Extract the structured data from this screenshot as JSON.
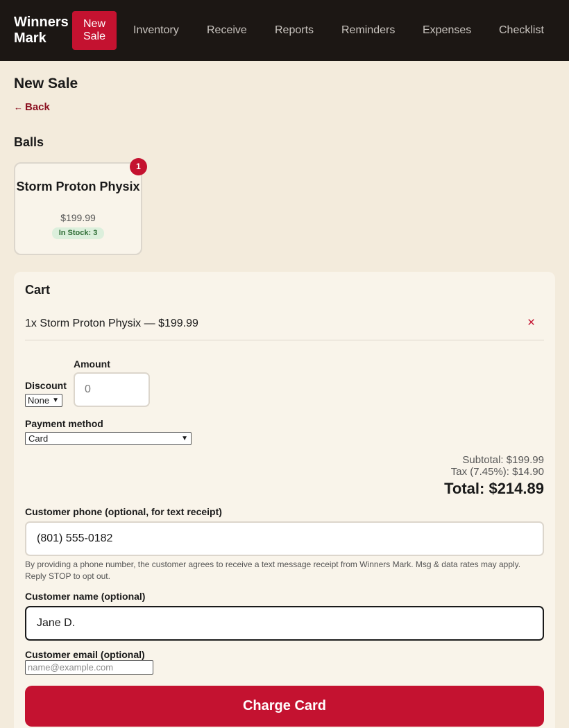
{
  "nav": {
    "brand": "Winners Mark",
    "items": [
      {
        "label": "New Sale",
        "active": true
      },
      {
        "label": "Inventory"
      },
      {
        "label": "Receive"
      },
      {
        "label": "Reports"
      },
      {
        "label": "Reminders"
      },
      {
        "label": "Expenses"
      },
      {
        "label": "Checklist"
      }
    ]
  },
  "page": {
    "title": "New Sale",
    "back_arrow": "←",
    "back_label": "Back"
  },
  "catalog": {
    "section_title": "Balls",
    "products": [
      {
        "name": "Storm Proton Physix",
        "price": "$199.99",
        "stock": "In Stock: 3",
        "cart_count": "1"
      }
    ]
  },
  "cart": {
    "title": "Cart",
    "items": [
      {
        "text": "1x Storm Proton Physix — $199.99",
        "remove_icon": "×"
      }
    ],
    "discount": {
      "label": "Discount",
      "selected": "None",
      "amount_label": "Amount",
      "amount_placeholder": "0"
    },
    "payment": {
      "label": "Payment method",
      "selected": "Card"
    },
    "totals": {
      "subtotal": "Subtotal: $199.99",
      "tax": "Tax (7.45%): $14.90",
      "total": "Total: $214.89"
    },
    "customer_phone": {
      "label": "Customer phone (optional, for text receipt)",
      "value": "(801) 555-0182"
    },
    "consent_text": "By providing a phone number, the customer agrees to receive a text message receipt from Winners Mark. Msg & data rates may apply. Reply STOP to opt out.",
    "customer_name": {
      "label": "Customer name (optional)",
      "value": "Jane D."
    },
    "customer_email": {
      "label": "Customer email (optional)",
      "placeholder": "name@example.com"
    },
    "charge_label": "Charge Card"
  },
  "colors": {
    "accent": "#c41230",
    "nav_bg": "#1c1714",
    "page_bg": "#f3ebdc",
    "panel_bg": "#f9f4ea"
  }
}
